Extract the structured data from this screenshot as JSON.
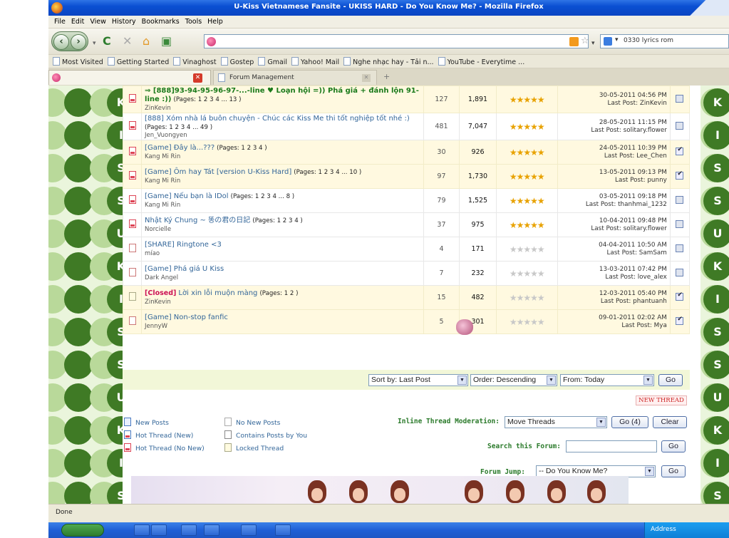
{
  "window": {
    "title": "U-Kiss Vietnamese Fansite - UKISS HARD - Do You Know Me? - Mozilla Firefox"
  },
  "menu": [
    "File",
    "Edit",
    "View",
    "History",
    "Bookmarks",
    "Tools",
    "Help"
  ],
  "search": {
    "value": "0330 lyrics rom"
  },
  "bookmarks": [
    "Most Visited",
    "Getting Started",
    "Vinaghost",
    "Gostep",
    "Gmail",
    "Yahoo! Mail",
    "Nghe nhạc hay - Tải n...",
    "YouTube - Everytime ..."
  ],
  "tabs": [
    {
      "label": ""
    },
    {
      "label": "Forum Management"
    }
  ],
  "side_letters": [
    "K",
    "I",
    "S",
    "S",
    "U",
    "K",
    "I",
    "S",
    "S",
    "U",
    "K",
    "I",
    "S"
  ],
  "threads": [
    {
      "title": "⇒ [888]93-94-95-96-97-...-line ♥ Loạn hội =)) Phá giá + đánh lộn 91-line :))",
      "pages": "(Pages: 1 2 3 4 ... 13 )",
      "author": "ZinKevin",
      "replies": "127",
      "views": "1,891",
      "rating": 5,
      "date": "30-05-2011 04:56 PM",
      "last": "Last Post: ZinKevin",
      "alt": true,
      "bold": true,
      "closed": ""
    },
    {
      "title": "[888] Xóm nhà lá buôn chuyện - Chúc các Kiss Me thi tốt nghiệp tốt nhé :)",
      "pages": "(Pages: 1 2 3 4 ... 49 )",
      "author": "Jen_Vuongyen",
      "replies": "481",
      "views": "7,047",
      "rating": 5,
      "date": "28-05-2011 11:15 PM",
      "last": "Last Post: solitary.flower",
      "alt": false,
      "bold": false,
      "closed": ""
    },
    {
      "title": "[Game] Đây là...???",
      "pages": "(Pages: 1 2 3 4 )",
      "author": "Kang Mi Rin",
      "replies": "30",
      "views": "926",
      "rating": 5,
      "date": "24-05-2011 10:39 PM",
      "last": "Last Post: Lee_Chen",
      "alt": true,
      "bold": false,
      "closed": ""
    },
    {
      "title": "[Game] Ôm hay Tát [version U-Kiss Hard]",
      "pages": "(Pages: 1 2 3 4 ... 10 )",
      "author": "Kang Mi Rin",
      "replies": "97",
      "views": "1,730",
      "rating": 5,
      "date": "13-05-2011 09:13 PM",
      "last": "Last Post: punny",
      "alt": true,
      "bold": false,
      "closed": ""
    },
    {
      "title": "[Game] Nếu bạn là IDol",
      "pages": "(Pages: 1 2 3 4 ... 8 )",
      "author": "Kang Mi Rin",
      "replies": "79",
      "views": "1,525",
      "rating": 5,
      "date": "03-05-2011 09:18 PM",
      "last": "Last Post: thanhmai_1232",
      "alt": false,
      "bold": false,
      "closed": ""
    },
    {
      "title": "Nhật Ký Chung ~ 똥の君の日記",
      "pages": "(Pages: 1 2 3 4 )",
      "author": "Norcielle",
      "replies": "37",
      "views": "975",
      "rating": 5,
      "date": "10-04-2011 09:48 PM",
      "last": "Last Post: solitary.flower",
      "alt": false,
      "bold": false,
      "closed": ""
    },
    {
      "title": "[SHARE] Ringtone <3",
      "pages": "",
      "author": "míao",
      "replies": "4",
      "views": "171",
      "rating": 0,
      "date": "04-04-2011 10:50 AM",
      "last": "Last Post: SamSam",
      "alt": false,
      "bold": false,
      "closed": ""
    },
    {
      "title": "[Game] Phá giá U Kiss",
      "pages": "",
      "author": "Dark Angel",
      "replies": "7",
      "views": "232",
      "rating": 0,
      "date": "13-03-2011 07:42 PM",
      "last": "Last Post: love_alex",
      "alt": false,
      "bold": false,
      "closed": ""
    },
    {
      "title": "Lời xin lỗi muộn màng",
      "pages": "(Pages: 1 2 )",
      "author": "ZinKevin",
      "replies": "15",
      "views": "482",
      "rating": 0,
      "date": "12-03-2011 05:40 PM",
      "last": "Last Post: phantuanh",
      "alt": true,
      "bold": false,
      "closed": "[Closed]"
    },
    {
      "title": "[Game] Non-stop fanfic",
      "pages": "",
      "author": "JennyW",
      "replies": "5",
      "views": "301",
      "rating": 0,
      "date": "09-01-2011 02:02 AM",
      "last": "Last Post: Mya",
      "alt": true,
      "bold": false,
      "closed": ""
    }
  ],
  "sort": {
    "sort_by": "Sort by: Last Post",
    "order": "Order: Descending",
    "from": "From: Today",
    "go": "Go"
  },
  "new_thread": "NEW THREAD",
  "legend": [
    "New Posts",
    "No New Posts",
    "Hot Thread (New)",
    "Contains Posts by You",
    "Hot Thread (No New)",
    "Locked Thread"
  ],
  "moderation": {
    "label": "Inline Thread Moderation:",
    "value": "Move Threads",
    "go": "Go (4)",
    "clear": "Clear"
  },
  "search_forum": {
    "label": "Search this Forum:",
    "go": "Go"
  },
  "forum_jump": {
    "label": "Forum Jump:",
    "value": "-- Do You Know Me?",
    "go": "Go"
  },
  "status": "Done",
  "tray": {
    "address": "Address"
  }
}
